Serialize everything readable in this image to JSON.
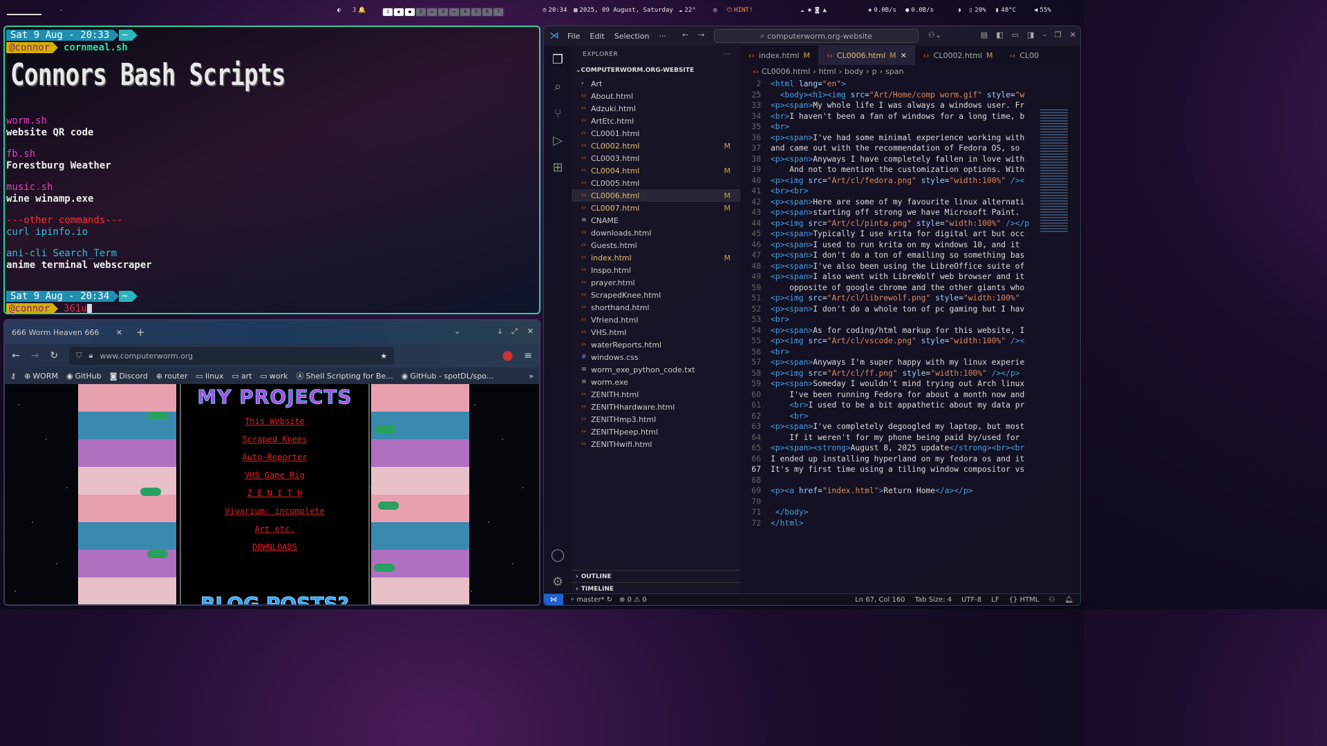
{
  "topbar": {
    "workspace_count": "3",
    "workspaces": [
      "1",
      "2",
      "3",
      "4",
      "5",
      "6",
      "7"
    ],
    "clock": "20:34",
    "date": "2025, 09 August, Saturday",
    "weather": "22°",
    "hint": "HINT!",
    "net_down": "0.0B/s",
    "net_up": "0.0B/s",
    "cpu": "20%",
    "temp": "48°C",
    "volume": "55%"
  },
  "terminal": {
    "prompt1_date": "Sat  9 Aug - 20:33",
    "prompt_tilde": "~",
    "user": "@connor",
    "command1": "cornmeal.sh",
    "banner": "Connors Bash Scripts",
    "scripts": [
      {
        "name": "worm.sh",
        "desc": "website QR code"
      },
      {
        "name": "fb.sh",
        "desc": "Forestburg Weather"
      },
      {
        "name": "music.sh",
        "desc": "wine winamp.exe"
      }
    ],
    "other_header": "---other commands---",
    "other_cmd": "curl ipinfo.io",
    "ani_cmd": "ani-cli Search_Term",
    "ani_desc": "anime terminal webscraper",
    "prompt2_date": "Sat  9 Aug - 20:34",
    "command2": "361u"
  },
  "browser": {
    "tab_title": "666 Worm Heaven 666",
    "url": "www.computerworm.org",
    "bookmarks": [
      "WORM",
      "GitHub",
      "Discord",
      "router",
      "linux",
      "art",
      "work",
      "Shell Scripting for Be...",
      "GitHub - spotDL/spo..."
    ],
    "projects_title": "MY PROJECTS",
    "project_links": [
      "This Website",
      "Scraped Knees",
      "Auto-Reporter",
      "VHS Game Rig",
      "Z E N I T H",
      "Vivarium: incomplete",
      "Art etc.",
      "DOWNLOADS"
    ],
    "blog_title": "BLOG POSTS?"
  },
  "vscode": {
    "menu": [
      "File",
      "Edit",
      "Selection",
      "···"
    ],
    "search": "computerworm.org-website",
    "explorer_label": "EXPLORER",
    "root": "COMPUTERWORM.ORG-WEBSITE",
    "files": [
      {
        "name": "Art",
        "mod": "",
        "type": "folder"
      },
      {
        "name": "About.html",
        "mod": "",
        "type": "html"
      },
      {
        "name": "Adzuki.html",
        "mod": "",
        "type": "html"
      },
      {
        "name": "ArtEtc.html",
        "mod": "",
        "type": "html"
      },
      {
        "name": "CL0001.html",
        "mod": "",
        "type": "html"
      },
      {
        "name": "CL0002.html",
        "mod": "M",
        "type": "html"
      },
      {
        "name": "CL0003.html",
        "mod": "",
        "type": "html"
      },
      {
        "name": "CL0004.html",
        "mod": "M",
        "type": "html"
      },
      {
        "name": "CL0005.html",
        "mod": "",
        "type": "html"
      },
      {
        "name": "CL0006.html",
        "mod": "M",
        "type": "html"
      },
      {
        "name": "CL0007.html",
        "mod": "M",
        "type": "html"
      },
      {
        "name": "CNAME",
        "mod": "",
        "type": "text"
      },
      {
        "name": "downloads.html",
        "mod": "",
        "type": "html"
      },
      {
        "name": "Guests.html",
        "mod": "",
        "type": "html"
      },
      {
        "name": "index.html",
        "mod": "M",
        "type": "html"
      },
      {
        "name": "Inspo.html",
        "mod": "",
        "type": "html"
      },
      {
        "name": "prayer.html",
        "mod": "",
        "type": "html"
      },
      {
        "name": "ScrapedKnee.html",
        "mod": "",
        "type": "html"
      },
      {
        "name": "shorthand.html",
        "mod": "",
        "type": "html"
      },
      {
        "name": "Vfriend.html",
        "mod": "",
        "type": "html"
      },
      {
        "name": "VHS.html",
        "mod": "",
        "type": "html"
      },
      {
        "name": "waterReports.html",
        "mod": "",
        "type": "html"
      },
      {
        "name": "windows.css",
        "mod": "",
        "type": "css"
      },
      {
        "name": "worm_exe_python_code.txt",
        "mod": "",
        "type": "text"
      },
      {
        "name": "worm.exe",
        "mod": "",
        "type": "text"
      },
      {
        "name": "ZENITH.html",
        "mod": "",
        "type": "html"
      },
      {
        "name": "ZENITHhardware.html",
        "mod": "",
        "type": "html"
      },
      {
        "name": "ZENITHmp3.html",
        "mod": "",
        "type": "html"
      },
      {
        "name": "ZENITHpeep.html",
        "mod": "",
        "type": "html"
      },
      {
        "name": "ZENITHwifi.html",
        "mod": "",
        "type": "html"
      }
    ],
    "outline": "OUTLINE",
    "timeline": "TIMELINE",
    "tabs": [
      {
        "name": "index.html",
        "mod": "M"
      },
      {
        "name": "CL0006.html",
        "mod": "M"
      },
      {
        "name": "CL0002.html",
        "mod": "M"
      },
      {
        "name": "CL00",
        "mod": ""
      }
    ],
    "breadcrumb": [
      "CL0006.html",
      "html",
      "body",
      "p",
      "span"
    ],
    "status": {
      "branch": "master*",
      "problems": "0 ⚠ 0",
      "position": "Ln 67, Col 160",
      "tabsize": "Tab Size: 4",
      "encoding": "UTF-8",
      "eol": "LF",
      "lang": "HTML"
    }
  }
}
